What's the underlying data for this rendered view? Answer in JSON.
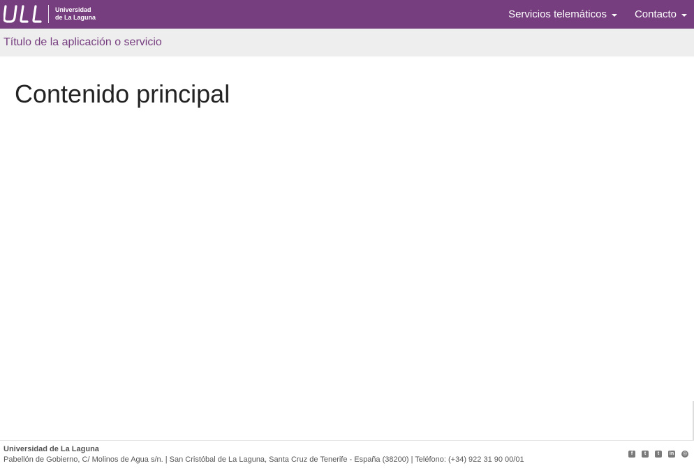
{
  "header": {
    "logo_mark": "ULL",
    "logo_line1": "Universidad",
    "logo_line2": "de La Laguna",
    "brand_color": "#763d7f",
    "nav": [
      {
        "label": "Servicios telemáticos",
        "icon": "caret-down-icon"
      },
      {
        "label": "Contacto",
        "icon": "caret-down-icon"
      }
    ]
  },
  "subheader": {
    "app_title": "Título de la aplicación o servicio",
    "background": "#eeeeee"
  },
  "main": {
    "heading": "Contenido principal"
  },
  "footer": {
    "organization": "Universidad de La Laguna",
    "address": "Pabellón de Gobierno, C/ Molinos de Agua s/n. | San Cristóbal de La Laguna, Santa Cruz de Tenerife - España (38200) | Teléfono: (+34) 922 31 90 00/01",
    "social": [
      {
        "icon": "facebook-icon",
        "glyph": "f"
      },
      {
        "icon": "tuenti-icon",
        "glyph": "t"
      },
      {
        "icon": "twitter-icon",
        "glyph": "t"
      },
      {
        "icon": "linkedin-icon",
        "glyph": "in"
      },
      {
        "icon": "globe-icon",
        "glyph": "◎"
      }
    ]
  }
}
